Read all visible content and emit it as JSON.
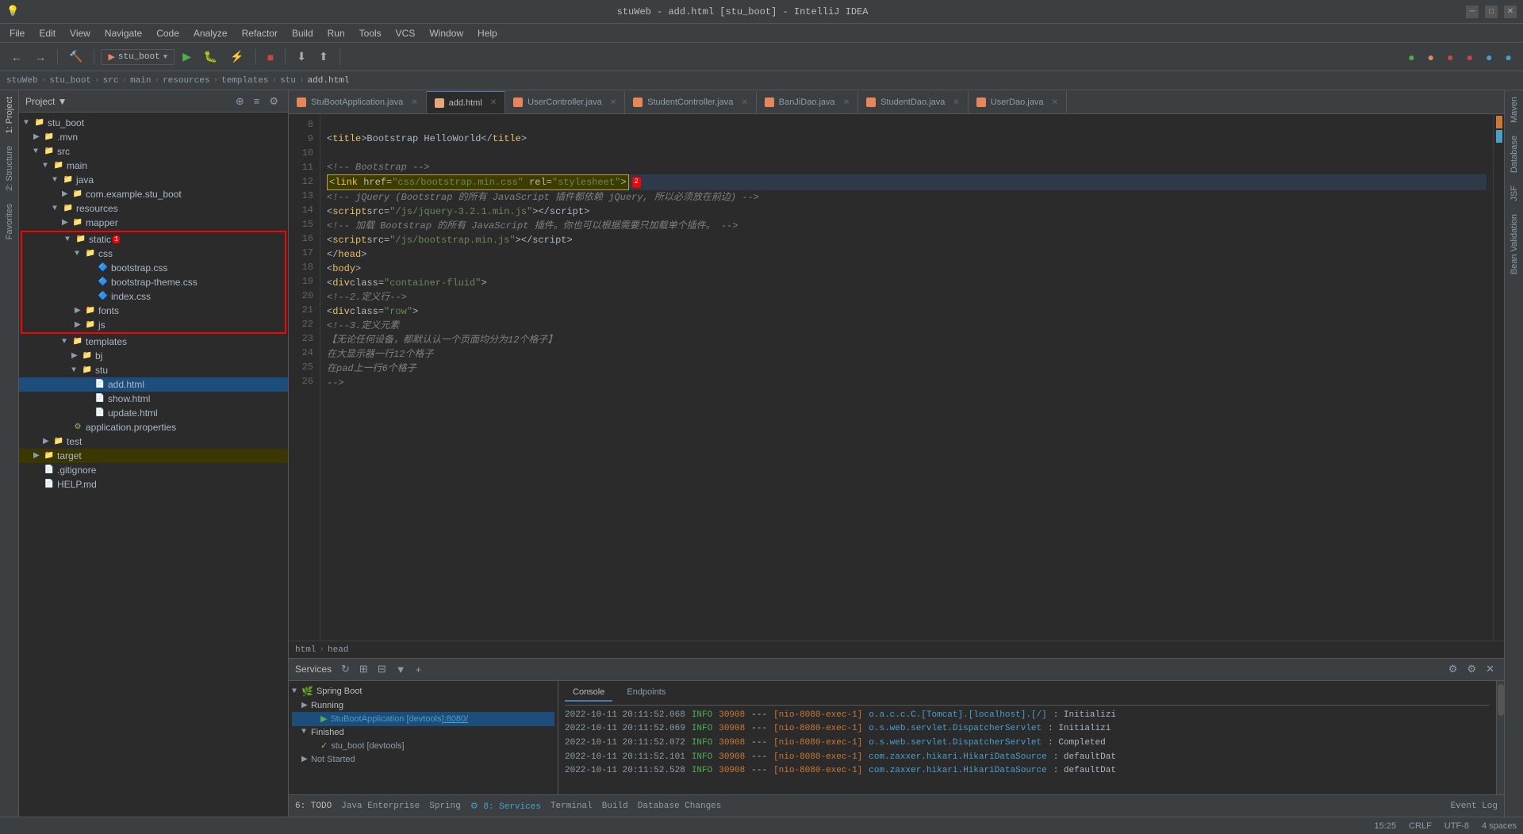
{
  "window": {
    "title": "stuWeb - add.html [stu_boot] - IntelliJ IDEA"
  },
  "menubar": {
    "items": [
      "File",
      "Edit",
      "View",
      "Navigate",
      "Code",
      "Analyze",
      "Refactor",
      "Build",
      "Run",
      "Tools",
      "VCS",
      "Window",
      "Help"
    ]
  },
  "breadcrumb": {
    "items": [
      "stuWeb",
      "stu_boot",
      "src",
      "main",
      "resources",
      "templates",
      "stu",
      "add.html"
    ]
  },
  "tabs": [
    {
      "label": "StuBootApplication.java",
      "type": "java",
      "active": false
    },
    {
      "label": "add.html",
      "type": "html",
      "active": true
    },
    {
      "label": "UserController.java",
      "type": "java",
      "active": false
    },
    {
      "label": "StudentController.java",
      "type": "java",
      "active": false
    },
    {
      "label": "BanJiDao.java",
      "type": "java",
      "active": false
    },
    {
      "label": "StudentDao.java",
      "type": "java",
      "active": false
    },
    {
      "label": "UserDao.java",
      "type": "java",
      "active": false
    }
  ],
  "editor": {
    "lines": [
      {
        "num": "8",
        "content": "",
        "type": "plain"
      },
      {
        "num": "9",
        "content": "        <title>Bootstrap HelloWorld</title>",
        "type": "plain"
      },
      {
        "num": "10",
        "content": "",
        "type": "plain"
      },
      {
        "num": "11",
        "content": "        <!-- Bootstrap -->",
        "type": "comment"
      },
      {
        "num": "12",
        "content": "        <link href=\"css/bootstrap.min.css\" rel=\"stylesheet\">",
        "type": "highlight",
        "highlighted": true
      },
      {
        "num": "13",
        "content": "        <!-- jQuery (Bootstrap 的所有 JavaScript 插件都依赖 jQuery, 所以必须放在前边) -->",
        "type": "comment"
      },
      {
        "num": "14",
        "content": "        <script src=\"/js/jquery-3.2.1.min.js\"></scri​pt>",
        "type": "plain"
      },
      {
        "num": "15",
        "content": "        <!-- 加载 Bootstrap 的所有 JavaScript 插件。你也可以根据需要只加载单个插件。 -->",
        "type": "comment"
      },
      {
        "num": "16",
        "content": "        <script src=\"/js/bootstrap.min.js\"></scri​pt>",
        "type": "plain"
      },
      {
        "num": "17",
        "content": "    </head>",
        "type": "plain"
      },
      {
        "num": "18",
        "content": "    <body>",
        "type": "plain"
      },
      {
        "num": "19",
        "content": "        <div class=\"container-fluid\">",
        "type": "plain"
      },
      {
        "num": "20",
        "content": "            <!--2.定义行-->",
        "type": "comment"
      },
      {
        "num": "21",
        "content": "            <div class=\"row\">",
        "type": "plain"
      },
      {
        "num": "22",
        "content": "                <!--3.定义元素",
        "type": "comment"
      },
      {
        "num": "23",
        "content": "                【无论任何设备，都默认认一个页面均分为12个格子】",
        "type": "comment"
      },
      {
        "num": "24",
        "content": "                        在大显示器一行12个格子",
        "type": "comment"
      },
      {
        "num": "25",
        "content": "                        在pad上一行6个格子",
        "type": "comment"
      },
      {
        "num": "26",
        "content": "                -->",
        "type": "comment"
      }
    ],
    "breadcrumb": "html › head"
  },
  "project_tree": {
    "root": "stu_boot",
    "items": [
      {
        "label": "stu_boot",
        "type": "folder",
        "indent": 0,
        "expanded": true
      },
      {
        "label": ".mvn",
        "type": "folder",
        "indent": 1,
        "expanded": false
      },
      {
        "label": "src",
        "type": "folder",
        "indent": 1,
        "expanded": true
      },
      {
        "label": "main",
        "type": "folder",
        "indent": 2,
        "expanded": true
      },
      {
        "label": "java",
        "type": "folder",
        "indent": 3,
        "expanded": true
      },
      {
        "label": "com.example.stu_boot",
        "type": "folder",
        "indent": 4,
        "expanded": false
      },
      {
        "label": "resources",
        "type": "folder",
        "indent": 3,
        "expanded": true
      },
      {
        "label": "mapper",
        "type": "folder",
        "indent": 4,
        "expanded": false
      },
      {
        "label": "static",
        "type": "folder",
        "indent": 4,
        "expanded": true,
        "badge": "1",
        "red_border": true
      },
      {
        "label": "css",
        "type": "folder",
        "indent": 5,
        "expanded": true
      },
      {
        "label": "bootstrap.css",
        "type": "css",
        "indent": 6
      },
      {
        "label": "bootstrap-theme.css",
        "type": "css",
        "indent": 6
      },
      {
        "label": "index.css",
        "type": "css",
        "indent": 6
      },
      {
        "label": "fonts",
        "type": "folder",
        "indent": 5,
        "expanded": false
      },
      {
        "label": "js",
        "type": "folder",
        "indent": 5,
        "expanded": false
      },
      {
        "label": "templates",
        "type": "folder",
        "indent": 4,
        "expanded": true
      },
      {
        "label": "bj",
        "type": "folder",
        "indent": 5,
        "expanded": false
      },
      {
        "label": "stu",
        "type": "folder",
        "indent": 5,
        "expanded": true
      },
      {
        "label": "add.html",
        "type": "html",
        "indent": 6,
        "selected": true
      },
      {
        "label": "show.html",
        "type": "html",
        "indent": 6
      },
      {
        "label": "update.html",
        "type": "html",
        "indent": 6
      },
      {
        "label": "application.properties",
        "type": "prop",
        "indent": 3
      },
      {
        "label": "test",
        "type": "folder",
        "indent": 2,
        "expanded": false
      },
      {
        "label": "target",
        "type": "folder",
        "indent": 1,
        "expanded": false,
        "highlighted": true
      },
      {
        "label": ".gitignore",
        "type": "git",
        "indent": 1
      },
      {
        "label": "HELP.md",
        "type": "md",
        "indent": 1
      }
    ]
  },
  "bottom_panel": {
    "title": "Services",
    "tabs": [
      "Console",
      "Endpoints"
    ],
    "service_tree": [
      {
        "label": "Spring Boot",
        "indent": 0,
        "expanded": true
      },
      {
        "label": "Running",
        "indent": 1,
        "expanded": true
      },
      {
        "label": "StuBootApplication [devtools] :8080/",
        "indent": 2,
        "selected": true
      },
      {
        "label": "Finished",
        "indent": 1,
        "expanded": true
      },
      {
        "label": "stu_boot [devtools]",
        "indent": 2
      },
      {
        "label": "Not Started",
        "indent": 1,
        "expanded": false
      }
    ],
    "log_lines": [
      {
        "time": "2022-10-11 20:11:52.068",
        "level": "INFO",
        "thread": "30908",
        "separator": "---",
        "exec": "[nio-8080-exec-1]",
        "class": "o.a.c.c.C.[Tomcat].[localhost].[/]",
        "msg": ": Initializi"
      },
      {
        "time": "2022-10-11 20:11:52.069",
        "level": "INFO",
        "thread": "30908",
        "separator": "---",
        "exec": "[nio-8080-exec-1]",
        "class": "o.s.web.servlet.DispatcherServlet",
        "msg": ": Initializi"
      },
      {
        "time": "2022-10-11 20:11:52.072",
        "level": "INFO",
        "thread": "30908",
        "separator": "---",
        "exec": "[nio-8080-exec-1]",
        "class": "o.s.web.servlet.DispatcherServlet",
        "msg": ": Completed"
      },
      {
        "time": "2022-10-11 20:11:52.101",
        "level": "INFO",
        "thread": "30908",
        "separator": "---",
        "exec": "[nio-8080-exec-1]",
        "class": "com.zaxxer.hikari.HikariDataSource",
        "msg": ": defaultDat"
      },
      {
        "time": "2022-10-11 20:11:52.528",
        "level": "INFO",
        "thread": "30908",
        "separator": "---",
        "exec": "[nio-8080-exec-1]",
        "class": "com.zaxxer.hikari.HikariDataSource",
        "msg": ": defaultDat"
      }
    ]
  },
  "status_bar": {
    "left": [
      "6: TODO",
      "Java Enterprise",
      "Spring",
      "8: Services",
      "Terminal",
      "Build",
      "Database Changes"
    ],
    "right": [
      "15:25",
      "CRLF",
      "UTF-8",
      "4 spaces"
    ],
    "event_log": "Event Log"
  },
  "run_config": "stu_boot"
}
